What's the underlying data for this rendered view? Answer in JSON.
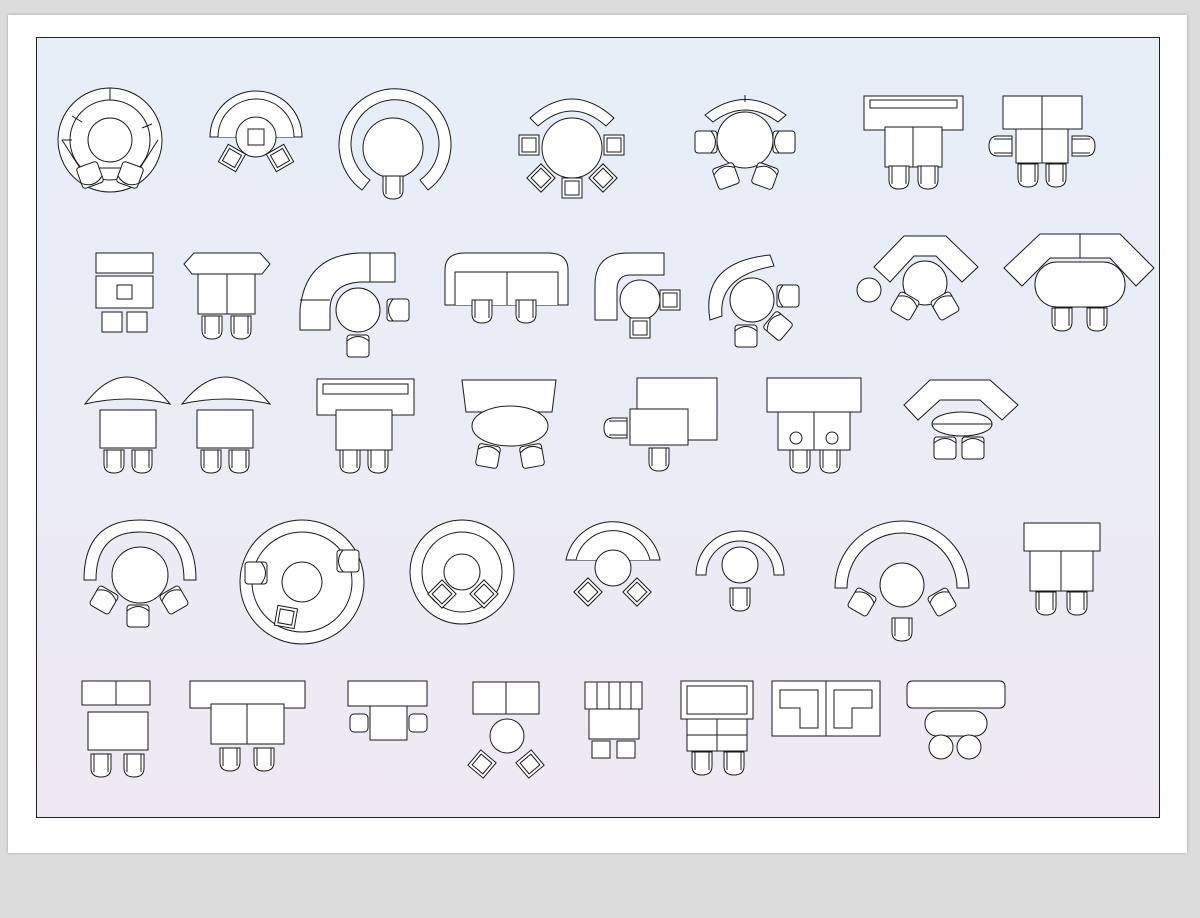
{
  "canvas": {
    "background": "#dcdcdc",
    "sheet_color": "#ffffff",
    "frame_color": "#222222",
    "gradient_top": "#e7eef8",
    "gradient_bottom": "#eee9f2",
    "line_color": "#1a1a1a",
    "fill_color": "#ffffff"
  },
  "sheet": {
    "rows": 5,
    "blocks_per_row": [
      7,
      8,
      7,
      7,
      8
    ],
    "labels": []
  }
}
